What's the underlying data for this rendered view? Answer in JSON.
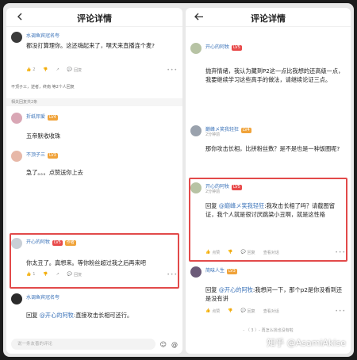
{
  "left": {
    "title": "评论详情",
    "c1": {
      "name": "水调鱼宾冠名夸",
      "text": "都没打算理你。这还嗨起来了，嘿天来直播连个麦?",
      "likes": "2",
      "replies_label": "回复"
    },
    "reply_summary": "不顶子三，逆者，终南 等2个人回复",
    "section_label": "相关回复共2条",
    "c2": {
      "name": "折纸邦爱",
      "level": "LV4",
      "text": "五帝默收收珠"
    },
    "c3": {
      "name": "不顶子三",
      "level": "LV3",
      "text": "急了。。。点赞送你上去"
    },
    "c4": {
      "name": "开心的阿牧",
      "level": "LV5",
      "tag": "作者",
      "text": "你太丑了。真想来。等你粉丝超过我之后再来吧",
      "likes": "1",
      "replies_label": "回复"
    },
    "c5": {
      "name": "水调鱼宾冠名夸",
      "reply_prefix": "回复",
      "at_name": "@开心的阿牧",
      "text": ":直接攻击长相可还行。"
    },
    "input_placeholder": "说一条友善的评论",
    "emoji_glyph": "☺",
    "at_glyph": "@"
  },
  "right": {
    "title": "评论详情",
    "c1": {
      "name": "开心的阿牧",
      "level": "LV5",
      "text": "抛弃情绪，我认为藏到P2这一点比我想的还高级一点，我要继续学习这些高手的做法，请继续论证三点。"
    },
    "c2": {
      "name": "巅峰メ笑我轻狂",
      "level": "LV4",
      "meta": "2分钟前",
      "text": "那你攻击长相，比拼粉丝数？是不是也是一种饭圈呢?"
    },
    "c3": {
      "name": "开心的阿牧",
      "level": "LV5",
      "meta": "2分钟前",
      "reply_prefix": "回复",
      "at_name": "@巅峰メ笑我轻狂",
      "text": ":我攻击长相了吗？请截图留证，我个人就是很讨厌跳梁小丑啊，就是这性格",
      "likes": "点赞",
      "replies_label": "回复",
      "more_label": "查看对话"
    },
    "c4": {
      "name": "简味人生",
      "level": "LV3",
      "reply_prefix": "回复",
      "at_name": "@开心的阿牧",
      "text": ":我想问一下，那个p2是你没看到还是没有讲",
      "likes": "点赞",
      "replies_label": "回复",
      "more_label": "查看对话"
    },
    "pager": "- 〈 3 〉- 再怎么找也没有啦",
    "watermark": "知乎 @AsamiAkise"
  }
}
